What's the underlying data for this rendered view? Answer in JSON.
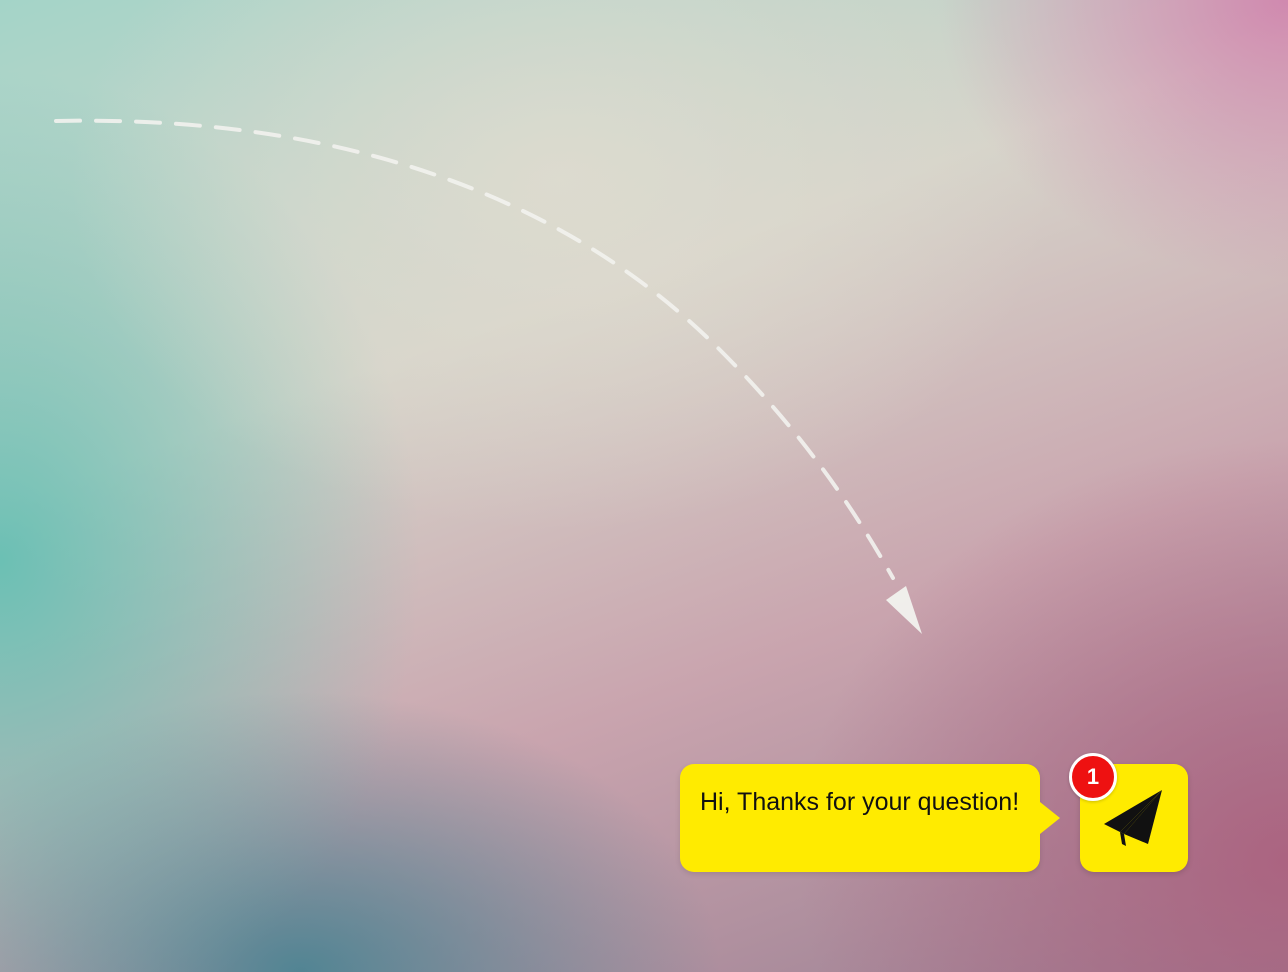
{
  "chat_widget": {
    "message": "Hi, Thanks for your question!",
    "badge_count": "1",
    "accent_color": "#ffeb00",
    "badge_color": "#ee1111",
    "launcher_icon": "paper-plane-icon"
  },
  "decorations": {
    "arrow_icon": "dashed-curved-arrow-icon"
  }
}
